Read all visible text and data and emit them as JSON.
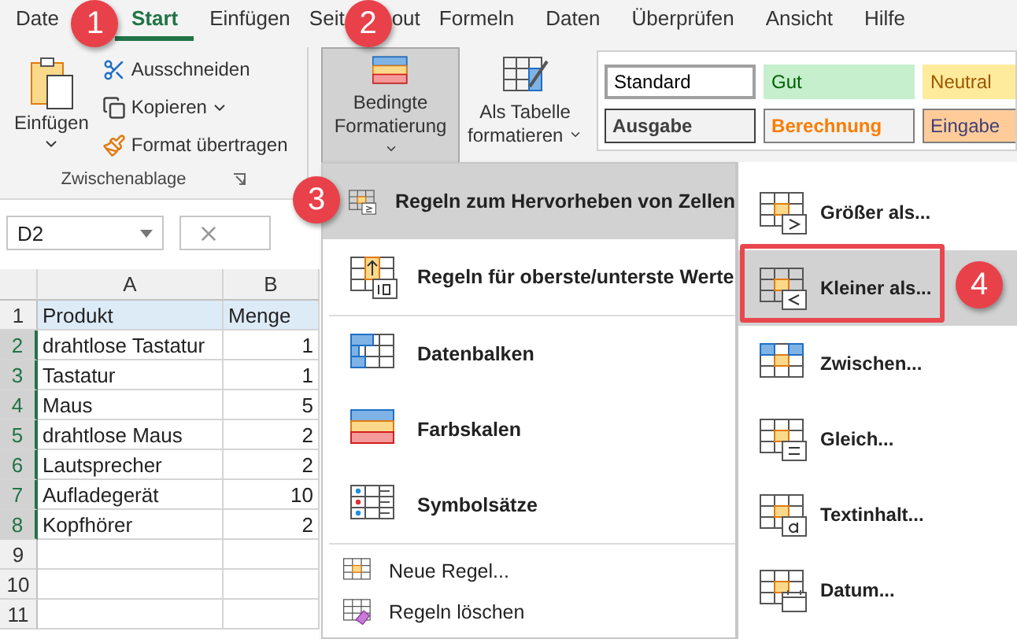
{
  "tabs": [
    {
      "parts": [
        "Date"
      ],
      "selected": false
    },
    {
      "parts": [
        "Start"
      ],
      "selected": true
    },
    {
      "parts": [
        "Einfügen"
      ],
      "selected": false
    },
    {
      "parts": [
        "Seit",
        "out"
      ],
      "selected": false
    },
    {
      "parts": [
        "Formeln"
      ],
      "selected": false
    },
    {
      "parts": [
        "Daten"
      ],
      "selected": false
    },
    {
      "parts": [
        "Überprüfen"
      ],
      "selected": false
    },
    {
      "parts": [
        "Ansicht"
      ],
      "selected": false
    },
    {
      "parts": [
        "Hilfe"
      ],
      "selected": false
    }
  ],
  "clipboard": {
    "paste": "Einfügen",
    "cut": "Ausschneiden",
    "copy": "Kopieren",
    "format_painter": "Format übertragen",
    "group_label": "Zwischenablage"
  },
  "conditional_formatting": {
    "line1": "Bedingte",
    "line2": "Formatierung",
    "pressed": true
  },
  "format_as_table": {
    "line1": "Als Tabelle",
    "line2": "formatieren"
  },
  "cell_styles": [
    {
      "label": "Standard",
      "kind": "normal"
    },
    {
      "label": "Gut",
      "kind": "good"
    },
    {
      "label": "Neutral",
      "kind": "neutral"
    },
    {
      "label": "Ausgabe",
      "kind": "output"
    },
    {
      "label": "Berechnung",
      "kind": "calculation"
    },
    {
      "label": "Eingabe",
      "kind": "input"
    }
  ],
  "name_box": "D2",
  "columns": [
    "A",
    "B"
  ],
  "rows": [
    {
      "number": "1",
      "kind": "header",
      "selected": false,
      "cells": [
        "Produkt",
        "Menge"
      ]
    },
    {
      "number": "2",
      "kind": "data",
      "selected": true,
      "cells": [
        "drahtlose Tastatur",
        "1"
      ]
    },
    {
      "number": "3",
      "kind": "data",
      "selected": true,
      "cells": [
        "Tastatur",
        "1"
      ]
    },
    {
      "number": "4",
      "kind": "data",
      "selected": true,
      "cells": [
        "Maus",
        "5"
      ]
    },
    {
      "number": "5",
      "kind": "data",
      "selected": true,
      "cells": [
        "drahtlose Maus",
        "2"
      ]
    },
    {
      "number": "6",
      "kind": "data",
      "selected": true,
      "cells": [
        "Lautsprecher",
        "2"
      ]
    },
    {
      "number": "7",
      "kind": "data",
      "selected": true,
      "cells": [
        "Aufladegerät",
        "10"
      ]
    },
    {
      "number": "8",
      "kind": "data",
      "selected": true,
      "cells": [
        "Kopfhörer",
        "2"
      ]
    },
    {
      "number": "9",
      "kind": "data",
      "selected": false,
      "cells": [
        "",
        ""
      ]
    },
    {
      "number": "10",
      "kind": "data",
      "selected": false,
      "cells": [
        "",
        ""
      ]
    },
    {
      "number": "11",
      "kind": "data",
      "selected": false,
      "cells": [
        "",
        ""
      ]
    }
  ],
  "menu": {
    "items": [
      {
        "label": "Regeln zum Hervorheben von Zellen",
        "kind": "highlight",
        "selected": true
      },
      {
        "label": "Regeln für oberste/unterste Werte",
        "kind": "topbottom",
        "selected": false
      },
      {
        "label": "Datenbalken",
        "kind": "databars",
        "selected": false
      },
      {
        "label": "Farbskalen",
        "kind": "colorscales",
        "selected": false
      },
      {
        "label": "Symbolsätze",
        "kind": "iconsets",
        "selected": false
      }
    ],
    "small_items": [
      {
        "label": "Neue Regel...",
        "kind": "new"
      },
      {
        "label": "Regeln löschen",
        "kind": "clear"
      }
    ]
  },
  "submenu": {
    "items": [
      {
        "label": "Größer als...",
        "kind": "greater",
        "selected": false
      },
      {
        "label": "Kleiner als...",
        "kind": "less",
        "selected": true
      },
      {
        "label": "Zwischen...",
        "kind": "between",
        "selected": false
      },
      {
        "label": "Gleich...",
        "kind": "equal",
        "selected": false
      },
      {
        "label": "Textinhalt...",
        "kind": "text",
        "selected": false
      },
      {
        "label": "Datum...",
        "kind": "date",
        "selected": false
      }
    ]
  },
  "callouts": [
    "1",
    "2",
    "3",
    "4"
  ]
}
